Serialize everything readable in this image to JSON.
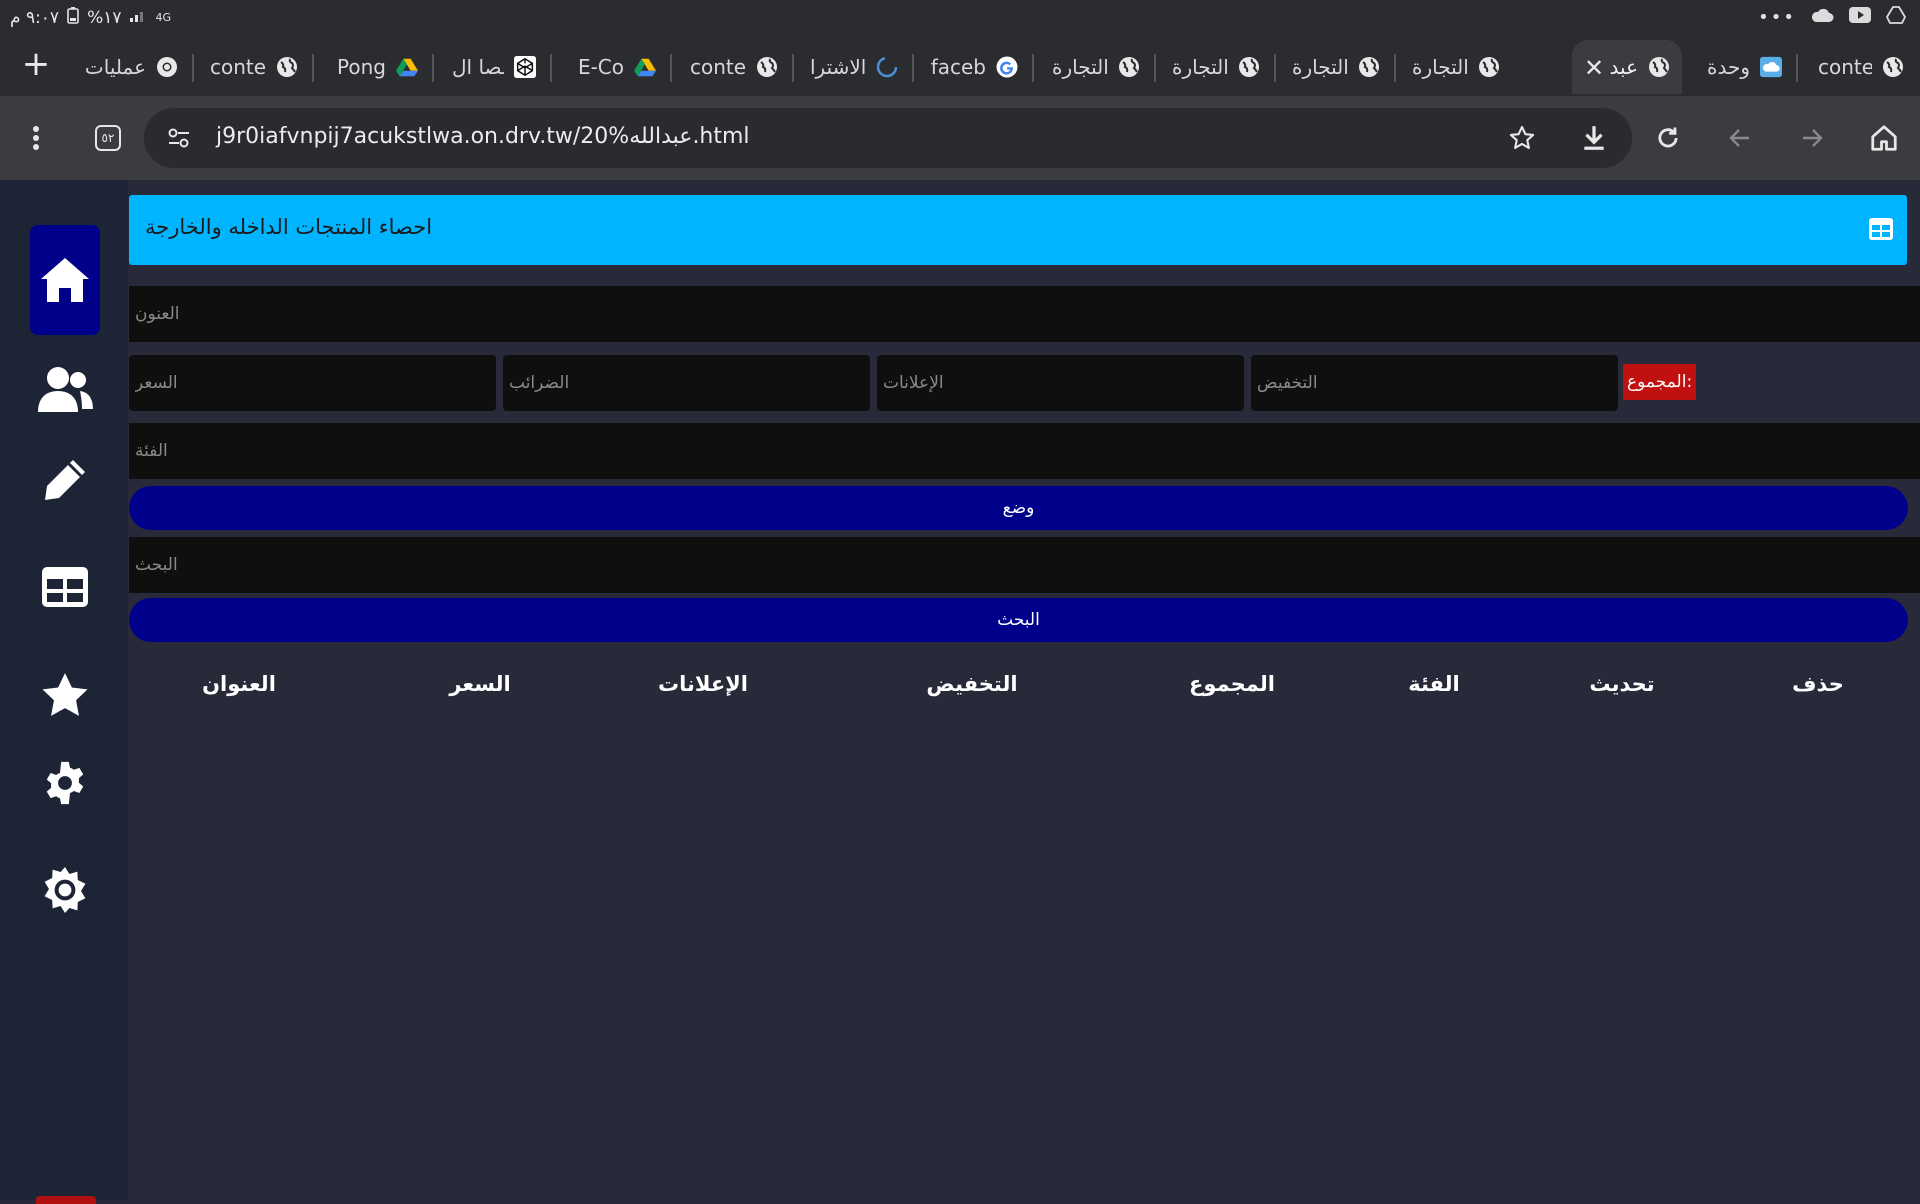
{
  "status_bar": {
    "time": "٩:٠٧ م",
    "battery": "%١٧",
    "network": "4G"
  },
  "tabs": [
    {
      "label": "عمليات",
      "icon": "chrome-icon"
    },
    {
      "label": "conte",
      "icon": "globe-icon"
    },
    {
      "label": "Pong",
      "icon": "drive-icon"
    },
    {
      "label": "عصا ال",
      "icon": "codepen-icon"
    },
    {
      "label": "E-Co",
      "icon": "drive-icon"
    },
    {
      "label": "conte",
      "icon": "globe-icon"
    },
    {
      "label": "الاشترا",
      "icon": "spinner-icon"
    },
    {
      "label": "faceb",
      "icon": "google-icon"
    },
    {
      "label": "التجارة",
      "icon": "globe-icon"
    },
    {
      "label": "التجارة",
      "icon": "globe-icon"
    },
    {
      "label": "التجارة",
      "icon": "globe-icon"
    },
    {
      "label": "التجارة",
      "icon": "globe-icon"
    },
    {
      "label": "عبد",
      "icon": "globe-icon",
      "active": true
    },
    {
      "label": "وحدة",
      "icon": "cloud-icon"
    },
    {
      "label": "conte",
      "icon": "globe-icon"
    }
  ],
  "toolbar": {
    "url": "j9r0iafvnpij7acukstlwa.on.drv.tw/20%عبدالله.html",
    "tab_count": "٥٢"
  },
  "header": {
    "title": "احصاء المنتجات الداخله والخارجة"
  },
  "form": {
    "title_placeholder": "العنون",
    "price_placeholder": "السعر",
    "taxes_placeholder": "الضرائب",
    "ads_placeholder": "الإعلانات",
    "discount_placeholder": "التخفيض",
    "total_label": ":المجموع",
    "category_placeholder": "الفئة",
    "create_button": "وضع",
    "search_placeholder": "البحث",
    "search_button": "البحث"
  },
  "table": {
    "headers": [
      "العنوان",
      "السعر",
      "الإعلانات",
      "التخفيض",
      "المجموع",
      "الفئة",
      "تحديث",
      "حذف"
    ]
  },
  "sidebar": {
    "items": [
      "home-icon",
      "users-icon",
      "pencil-icon",
      "table-icon",
      "star-icon",
      "gear-icon",
      "sun-icon"
    ]
  },
  "colors": {
    "header_bg": "#00b4ff",
    "button_bg": "#00008b",
    "badge_bg": "#c01010",
    "sidebar_bg": "#1c2436",
    "page_bg": "#282a3a"
  }
}
